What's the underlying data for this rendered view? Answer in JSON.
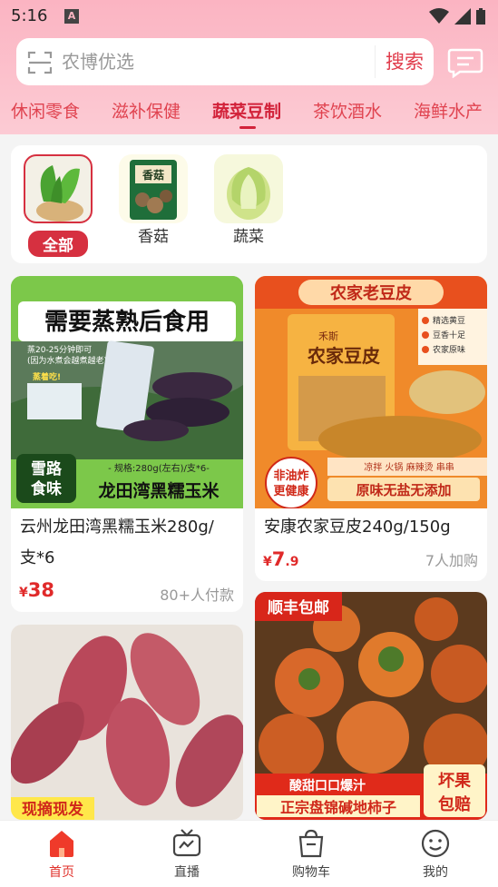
{
  "status": {
    "time": "5:16"
  },
  "search": {
    "placeholder": "农博优选",
    "button": "搜索"
  },
  "categories": [
    "休闲零食",
    "滋补保健",
    "蔬菜豆制",
    "茶饮酒水",
    "海鲜水产"
  ],
  "active_category": "蔬菜豆制",
  "subcategories": [
    {
      "label": "全部",
      "active": true
    },
    {
      "label": "香菇",
      "package_text": "香菇",
      "active": false
    },
    {
      "label": "蔬菜",
      "active": false
    }
  ],
  "products": [
    {
      "title_line1": "云州龙田湾黑糯玉米280g/",
      "title_line2": "支*6",
      "currency": "¥",
      "price_int": "38",
      "price_dec": "",
      "sold": "80+人付款",
      "banner_top": "需要蒸熟后食用",
      "banner_note1": "蒸20-25分钟即可",
      "banner_note2": "(因为水煮会越煮越老)",
      "banner_tag": "蒸着吃!",
      "badge": "雪路食味",
      "spec": "- 规格:280g(左右)/支*6-",
      "banner_name": "龙田湾黑糯玉米"
    },
    {
      "title_line1": "安康农家豆皮240g/150g",
      "currency": "¥",
      "price_int": "7",
      "price_dec": ".9",
      "sold": "7人加购",
      "banner_top": "农家老豆皮",
      "pkg_brand": "禾斯",
      "pkg_name": "农家豆皮",
      "features": [
        "精选黄豆",
        "豆香十足",
        "农家原味"
      ],
      "tags": "凉拌 火锅 麻辣烫 串串",
      "seal": "非油炸更健康",
      "bottom": "原味无盐无添加"
    },
    {
      "badge": "现摘现发"
    },
    {
      "badge": "顺丰包邮",
      "line1": "酸甜口口爆汁",
      "line2": "正宗盘锦碱地柿子",
      "promise1": "坏果",
      "promise2": "包赔"
    }
  ],
  "tabs": [
    {
      "label": "首页",
      "active": true
    },
    {
      "label": "直播",
      "active": false
    },
    {
      "label": "购物车",
      "active": false
    },
    {
      "label": "我的",
      "active": false
    }
  ],
  "colors": {
    "accent": "#d2223a",
    "header": "#fbb4c2",
    "price": "#e02a2a"
  }
}
